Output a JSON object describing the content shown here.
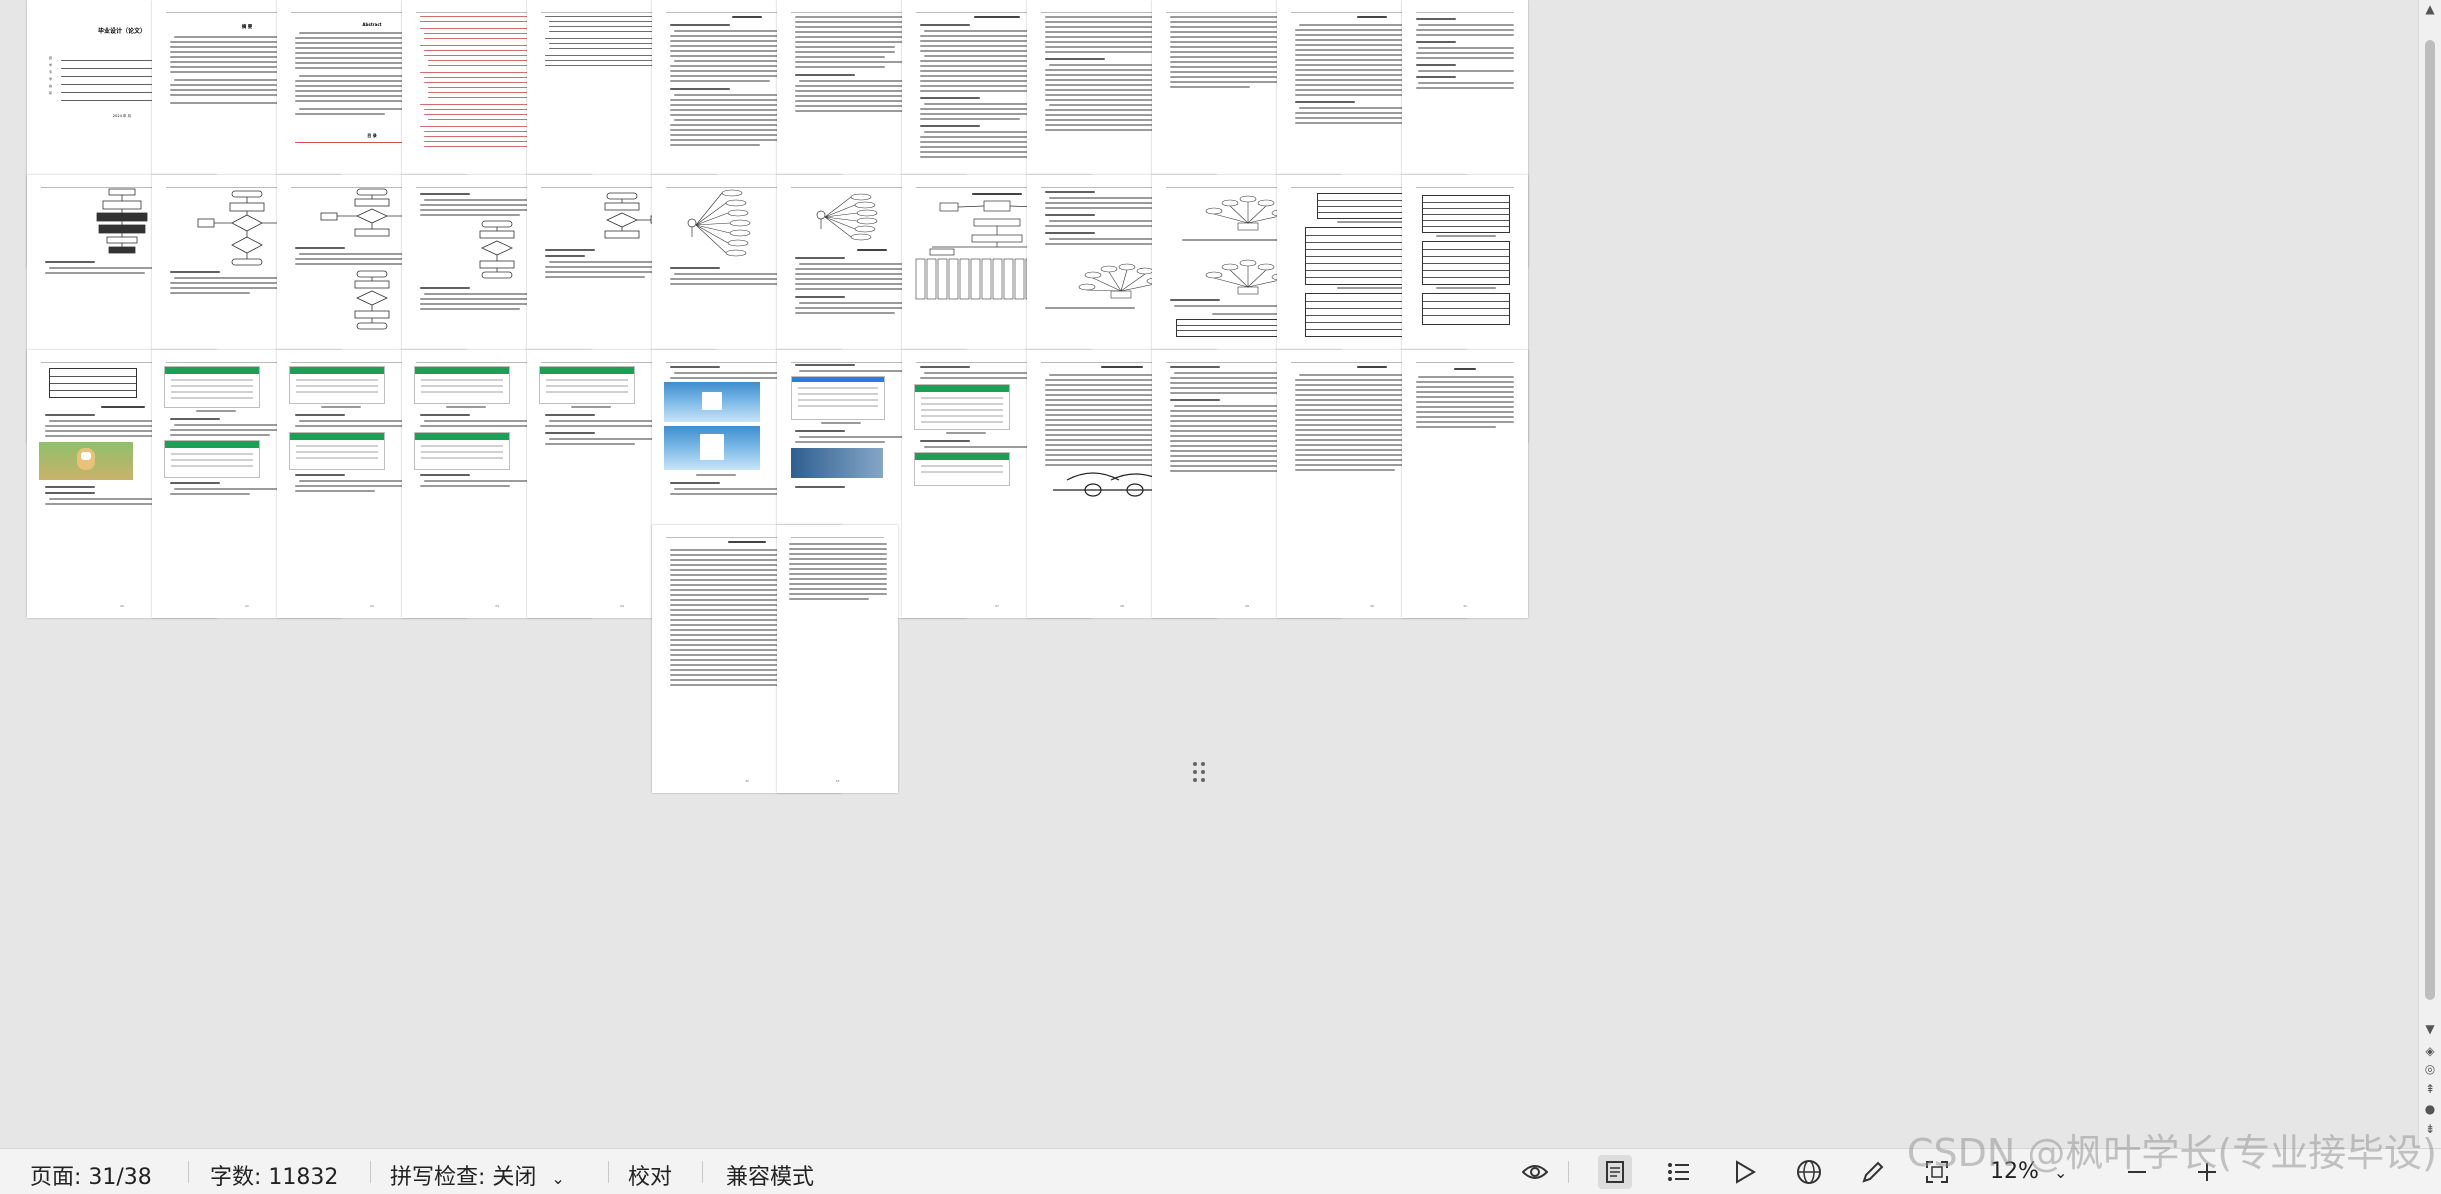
{
  "document": {
    "cover": {
      "title": "毕业设计（论文）",
      "date": "2024 年 月"
    },
    "abstract_cn_heading": "摘 要",
    "abstract_en_heading": "Abstract",
    "toc_heading": "目 录"
  },
  "status_bar": {
    "page": "页面: 31/38",
    "word_count": "字数: 11832",
    "spell_check": "拼写检查: 关闭",
    "proofread": "校对",
    "compat_mode": "兼容模式",
    "zoom": "12%"
  },
  "watermark": "CSDN @枫叶学长(专业接毕设)",
  "colors": {
    "canvas": "#e6e6e6",
    "page": "#ffffff",
    "app_green": "#1f9e55",
    "status_bar": "#f3f3f3"
  },
  "icons": [
    "eye-icon",
    "page-view-icon",
    "outline-icon",
    "play-icon",
    "globe-icon",
    "pen-icon",
    "fit-page-icon",
    "zoom-out-icon",
    "zoom-in-icon"
  ]
}
